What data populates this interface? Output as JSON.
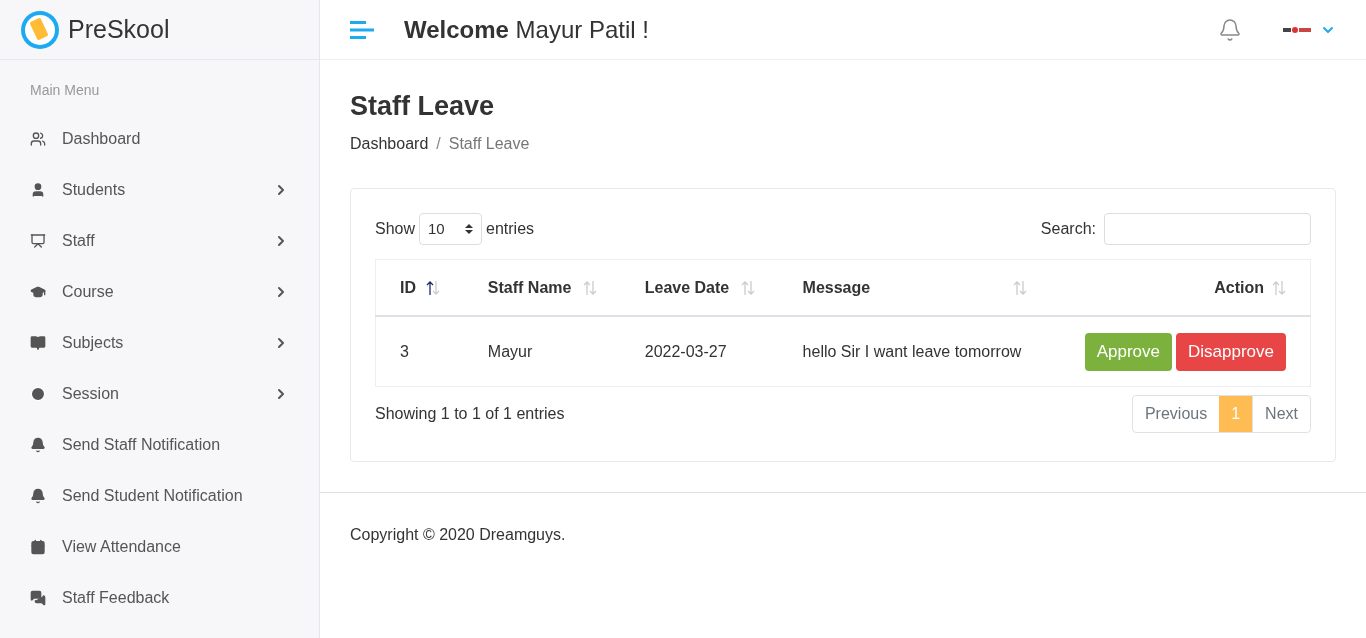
{
  "brand": {
    "name": "PreSkool"
  },
  "header": {
    "greeting_bold": "Welcome",
    "greeting_name": "Mayur Patil !"
  },
  "sidebar": {
    "section_title": "Main Menu",
    "items": [
      {
        "label": "Dashboard",
        "kind": "dashboard",
        "has_submenu": false
      },
      {
        "label": "Students",
        "kind": "student",
        "has_submenu": true
      },
      {
        "label": "Staff",
        "kind": "staff",
        "has_submenu": true
      },
      {
        "label": "Course",
        "kind": "course",
        "has_submenu": true
      },
      {
        "label": "Subjects",
        "kind": "subject",
        "has_submenu": true
      },
      {
        "label": "Session",
        "kind": "session",
        "has_submenu": true
      },
      {
        "label": "Send Staff Notification",
        "kind": "notification",
        "has_submenu": false
      },
      {
        "label": "Send Student Notification",
        "kind": "notification",
        "has_submenu": false
      },
      {
        "label": "View Attendance",
        "kind": "attendance",
        "has_submenu": false
      },
      {
        "label": "Staff Feedback",
        "kind": "feedback",
        "has_submenu": false
      }
    ]
  },
  "page": {
    "title": "Staff Leave",
    "breadcrumb_separator": "/",
    "breadcrumb": [
      {
        "label": "Dashboard",
        "current": false
      },
      {
        "label": "Staff Leave",
        "current": true
      }
    ]
  },
  "table_controls": {
    "show_label": "Show",
    "page_size": "10",
    "entries_label": "entries",
    "search_label": "Search:"
  },
  "table": {
    "columns": [
      {
        "label": "ID",
        "sorted": true
      },
      {
        "label": "Staff Name",
        "sorted": false
      },
      {
        "label": "Leave Date",
        "sorted": false
      },
      {
        "label": "Message",
        "sorted": false
      },
      {
        "label": "Action",
        "sorted": false
      }
    ],
    "rows": [
      {
        "id": "3",
        "staff_name": "Mayur",
        "leave_date": "2022-03-27",
        "message": "hello Sir I want leave tomorrow",
        "actions": [
          {
            "label": "Approve",
            "kind": "approve"
          },
          {
            "label": "Disapprove",
            "kind": "disapprove"
          }
        ]
      }
    ]
  },
  "table_info": "Showing 1 to 1 of 1 entries",
  "pagination": {
    "previous": {
      "label": "Previous",
      "disabled": true
    },
    "pages": [
      {
        "label": "1",
        "selected": true
      }
    ],
    "next": {
      "label": "Next",
      "disabled": true
    }
  },
  "footer": {
    "copyright": "Copyright © 2020 Dreamguys."
  }
}
